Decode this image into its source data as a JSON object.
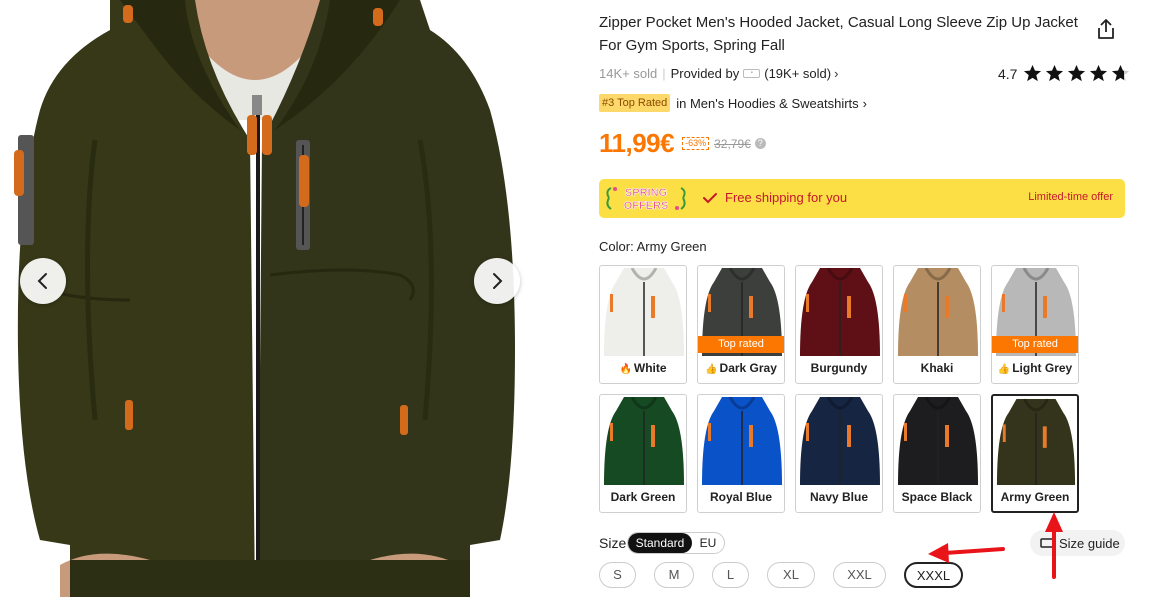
{
  "gallery": {
    "prev_icon": "chevron-left-icon",
    "next_icon": "chevron-right-icon"
  },
  "product": {
    "title": "Zipper Pocket Men's Hooded Jacket, Casual Long Sleeve Zip Up Jacket For Gym Sports, Spring Fall",
    "share_icon": "share-icon",
    "sold": "14K+ sold",
    "provided_by": "Provided by",
    "provider_sold": "(19K+ sold)",
    "rating": "4.7",
    "rating_value": 4.7,
    "rank_badge": "#3 Top Rated",
    "rank_category": "in Men's Hoodies & Sweatshirts",
    "price": "11,99€",
    "discount": "-63%",
    "original_price": "32,79€"
  },
  "promo": {
    "logo_line1": "SPRING",
    "logo_line2": "OFFERS",
    "shipping": "Free shipping for you",
    "limited": "Limited-time offer",
    "bg_color": "#fbdf45",
    "text_color": "#c6172c"
  },
  "color": {
    "label": "Color: Army Green",
    "selected": "Army Green",
    "options": [
      {
        "name": "White",
        "hex": "#eeeeea",
        "top_rated": false,
        "flame": true
      },
      {
        "name": "Dark Gray",
        "hex": "#3d3f3d",
        "top_rated": true,
        "badge": "Top rated"
      },
      {
        "name": "Burgundy",
        "hex": "#5e1016",
        "top_rated": false
      },
      {
        "name": "Khaki",
        "hex": "#b48e62",
        "top_rated": false
      },
      {
        "name": "Light Grey",
        "hex": "#b8b8b8",
        "top_rated": true,
        "badge": "Top rated"
      },
      {
        "name": "Dark Green",
        "hex": "#164a22",
        "top_rated": false
      },
      {
        "name": "Royal Blue",
        "hex": "#0a52c8",
        "top_rated": false
      },
      {
        "name": "Navy Blue",
        "hex": "#162542",
        "top_rated": false
      },
      {
        "name": "Space Black",
        "hex": "#1d1d1f",
        "top_rated": false
      },
      {
        "name": "Army Green",
        "hex": "#33341b",
        "top_rated": false
      }
    ]
  },
  "size": {
    "label": "Size",
    "systems": [
      "Standard",
      "EU"
    ],
    "active_system": "Standard",
    "guide_label": "Size guide",
    "options": [
      "S",
      "M",
      "L",
      "XL",
      "XXL",
      "XXXL"
    ],
    "selected": "XXXL"
  },
  "colors": {
    "accent": "#fb7701",
    "annotation_arrow": "#e8141a"
  }
}
